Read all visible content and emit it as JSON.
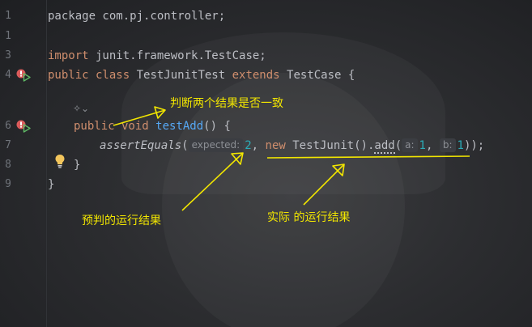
{
  "editor": {
    "line_numbers": [
      "1",
      "1",
      "3",
      "4",
      "",
      "6",
      "7",
      "8",
      "9"
    ],
    "code": {
      "line1": "package com.pj.controller;",
      "line3_kw": "import",
      "line3_rest": " junit.framework.TestCase;",
      "line4_kw1": "public class",
      "line4_name": " TestJunitTest ",
      "line4_kw2": "extends",
      "line4_rest": " TestCase {",
      "line6_kw": "public void",
      "line6_fn": "testAdd",
      "line6_rest": "() {",
      "line7_call": "assertEquals",
      "line7_paren": "(",
      "line7_hint_expected": "expected:",
      "line7_val": "2",
      "line7_comma": ", ",
      "line7_new": "new",
      "line7_ctor": " TestJunit().",
      "line7_add": "add",
      "line7_paren2": "(",
      "line7_hint_a": "a:",
      "line7_a": "1",
      "line7_comma2": ", ",
      "line7_hint_b": "b:",
      "line7_b": "1",
      "line7_end": "));",
      "line8": "}",
      "line9": "}"
    }
  },
  "annotations": {
    "compare": "判断两个结果是否一致",
    "expected": "预判的运行结果",
    "actual": "实际 的运行结果",
    "color": "#f2e600"
  },
  "icons": {
    "run": "run-test-icon",
    "breakpoint": "breakpoint-icon",
    "bulb": "lightbulb-icon",
    "ai": "ai-assistant-icon"
  }
}
